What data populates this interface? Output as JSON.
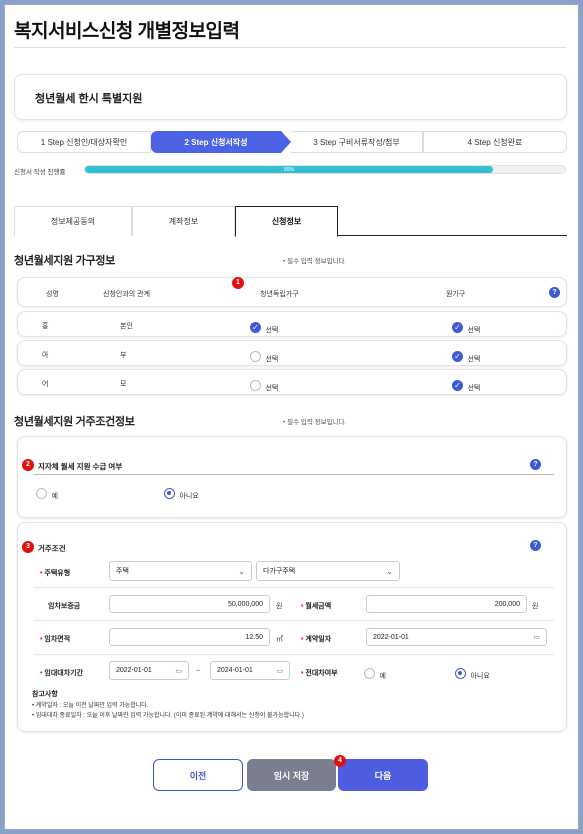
{
  "page_title": "복지서비스신청 개별정보입력",
  "service_name": "청년월세 한시 특별지원",
  "steps": [
    {
      "label": "1 Step 신청인/대상자확인"
    },
    {
      "label": "2 Step 신청서작성"
    },
    {
      "label": "3 Step 구비서류작성/첨부"
    },
    {
      "label": "4 Step 신청완료"
    }
  ],
  "progress": {
    "label": "신청서 작성 진행률",
    "percent_text": "85%",
    "value": 0.85
  },
  "tabs": [
    {
      "label": "정보제공동의"
    },
    {
      "label": "계좌정보"
    },
    {
      "label": "신청정보"
    }
  ],
  "household": {
    "title": "청년월세지원 가구정보",
    "required_note": "필수 입력 정보입니다.",
    "headers": {
      "name": "성명",
      "relation": "신청인과의 관계",
      "youth_independent": "청년독립가구",
      "original": "원가구"
    },
    "rows": [
      {
        "name": "홍",
        "relation": "본인",
        "youth_checked": true,
        "youth_label": "선택",
        "orig_checked": true,
        "orig_label": "선택"
      },
      {
        "name": "아",
        "relation": "부",
        "youth_checked": false,
        "youth_label": "선택",
        "orig_checked": true,
        "orig_label": "선택"
      },
      {
        "name": "어",
        "relation": "모",
        "youth_checked": false,
        "youth_label": "선택",
        "orig_checked": true,
        "orig_label": "선택"
      }
    ]
  },
  "housing": {
    "title": "청년월세지원 거주조건정보",
    "required_note": "필수 입력 정보입니다.",
    "local_support": {
      "title": "지자체 월세 지원 수급 여부",
      "opt_yes": "예",
      "opt_no": "아니요",
      "selected": "아니요"
    },
    "condition": {
      "title": "거주조건",
      "housing_type_label": "주택유형",
      "housing_type_value": "주택",
      "housing_subtype_value": "다가구주택",
      "deposit_label": "임차보증금",
      "deposit_value": "50,000,000",
      "deposit_unit": "원",
      "rent_label": "월세금액",
      "rent_value": "200,000",
      "rent_unit": "원",
      "area_label": "임차면적",
      "area_value": "12.50",
      "area_unit": "㎡",
      "contract_label": "계약일자",
      "contract_value": "2022-01-01",
      "lease_label": "임대대차기간",
      "lease_start": "2022-01-01",
      "lease_tilde": "~",
      "lease_end": "2024-01-01",
      "sublease_label": "전대차여부",
      "sublease_yes": "예",
      "sublease_no": "아니요",
      "sublease_selected": "아니요"
    },
    "notes_title": "참고사항",
    "notes": [
      "계약일자 : 오늘 이전 날짜만 입력 가능합니다.",
      "임대대차 종료일자 : 오늘 이후 날짜만 입력 가능합니다. (이미 종료된 계약에 대해서는 신청이 불가능합니다.)"
    ]
  },
  "badges": {
    "b1": "1",
    "b2": "2",
    "b3": "3",
    "b4": "4"
  },
  "buttons": {
    "prev": "이전",
    "save": "임시 저장",
    "next": "다음"
  },
  "colors": {
    "primary": "#4d63e6",
    "progress": "#32c0d2",
    "badge": "#e01010",
    "save_button": "#7a7e8e"
  }
}
